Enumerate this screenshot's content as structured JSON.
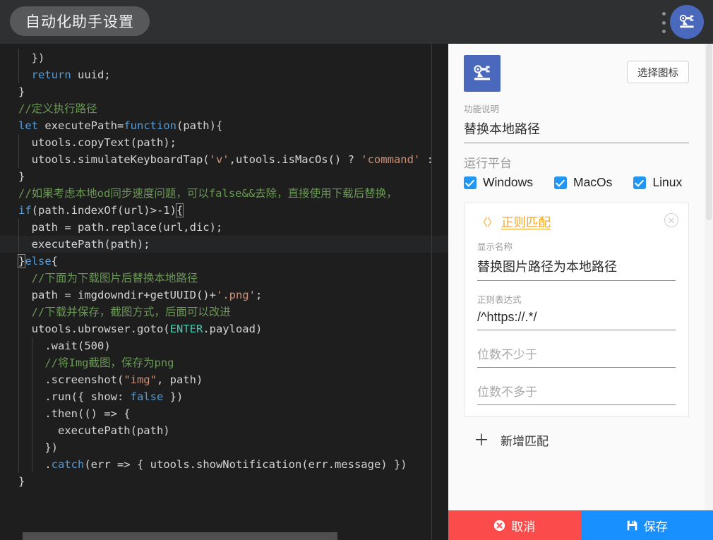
{
  "window": {
    "title": "自动化助手设置",
    "menu_icon": "kebab-menu-icon",
    "app_icon": "robot-arm-icon"
  },
  "editor": {
    "language": "javascript",
    "background": "#1e1e1e",
    "lines": [
      {
        "indent": 1,
        "tokens": [
          {
            "t": "plain",
            "s": "  })"
          }
        ]
      },
      {
        "indent": 1,
        "tokens": [
          {
            "t": "kw",
            "s": "  return"
          },
          {
            "t": "plain",
            "s": " uuid;"
          }
        ]
      },
      {
        "indent": 0,
        "tokens": [
          {
            "t": "plain",
            "s": "}"
          }
        ]
      },
      {
        "indent": 0,
        "tokens": [
          {
            "t": "cmt",
            "s": "//定义执行路径"
          }
        ]
      },
      {
        "indent": 0,
        "tokens": [
          {
            "t": "kw",
            "s": "let"
          },
          {
            "t": "plain",
            "s": " executePath="
          },
          {
            "t": "kw",
            "s": "function"
          },
          {
            "t": "plain",
            "s": "(path){"
          }
        ]
      },
      {
        "indent": 1,
        "tokens": [
          {
            "t": "plain",
            "s": "  utools.copyText(path);"
          }
        ]
      },
      {
        "indent": 1,
        "tokens": [
          {
            "t": "plain",
            "s": "  utools.simulateKeyboardTap("
          },
          {
            "t": "str",
            "s": "'v'"
          },
          {
            "t": "plain",
            "s": ",utools.isMacOs() ? "
          },
          {
            "t": "str",
            "s": "'command'"
          },
          {
            "t": "plain",
            "s": " :"
          }
        ]
      },
      {
        "indent": 0,
        "tokens": [
          {
            "t": "plain",
            "s": "}"
          }
        ]
      },
      {
        "indent": 0,
        "tokens": [
          {
            "t": "cmt",
            "s": "//如果考虑本地od同步速度问题，可以false&&去除，直接使用下载后替换，"
          }
        ]
      },
      {
        "indent": 0,
        "tokens": [
          {
            "t": "kw",
            "s": "if"
          },
          {
            "t": "plain",
            "s": "(path.indexOf(url)>-1)"
          },
          {
            "t": "brk",
            "s": "{"
          }
        ]
      },
      {
        "indent": 1,
        "tokens": [
          {
            "t": "plain",
            "s": "  path = path.replace(url,dic);"
          }
        ]
      },
      {
        "indent": 1,
        "current": true,
        "tokens": [
          {
            "t": "plain",
            "s": "  executePath(path);"
          }
        ]
      },
      {
        "indent": 0,
        "tokens": [
          {
            "t": "brk",
            "s": "}"
          },
          {
            "t": "kw",
            "s": "else"
          },
          {
            "t": "plain",
            "s": "{"
          }
        ]
      },
      {
        "indent": 1,
        "tokens": [
          {
            "t": "cmt",
            "s": "  //下面为下载图片后替换本地路径"
          }
        ]
      },
      {
        "indent": 1,
        "tokens": [
          {
            "t": "plain",
            "s": "  path = imgdowndir+getUUID()+"
          },
          {
            "t": "str",
            "s": "'.png'"
          },
          {
            "t": "plain",
            "s": ";"
          }
        ]
      },
      {
        "indent": 1,
        "tokens": [
          {
            "t": "cmt",
            "s": "  //下载并保存，截图方式，后面可以改进"
          }
        ]
      },
      {
        "indent": 1,
        "tokens": [
          {
            "t": "plain",
            "s": "  utools.ubrowser.goto("
          },
          {
            "t": "cls",
            "s": "ENTER"
          },
          {
            "t": "plain",
            "s": ".payload)"
          }
        ]
      },
      {
        "indent": 2,
        "tokens": [
          {
            "t": "plain",
            "s": "    .wait(500)"
          }
        ]
      },
      {
        "indent": 2,
        "tokens": [
          {
            "t": "cmt",
            "s": "    //将Img截图，保存为png"
          }
        ]
      },
      {
        "indent": 2,
        "tokens": [
          {
            "t": "plain",
            "s": "    .screenshot("
          },
          {
            "t": "str",
            "s": "\"img\""
          },
          {
            "t": "plain",
            "s": ", path)"
          }
        ]
      },
      {
        "indent": 2,
        "tokens": [
          {
            "t": "plain",
            "s": "    .run({ show: "
          },
          {
            "t": "kw",
            "s": "false"
          },
          {
            "t": "plain",
            "s": " })"
          }
        ]
      },
      {
        "indent": 2,
        "tokens": [
          {
            "t": "plain",
            "s": "    .then(() => {"
          }
        ]
      },
      {
        "indent": 2,
        "tokens": [
          {
            "t": "plain",
            "s": "      executePath(path)"
          }
        ]
      },
      {
        "indent": 2,
        "tokens": [
          {
            "t": "plain",
            "s": "    })"
          }
        ]
      },
      {
        "indent": 2,
        "tokens": [
          {
            "t": "plain",
            "s": "    ."
          },
          {
            "t": "mth",
            "s": "catch"
          },
          {
            "t": "plain",
            "s": "(err => { utools.showNotification(err.message) })"
          }
        ]
      },
      {
        "indent": 0,
        "tokens": [
          {
            "t": "plain",
            "s": "}"
          }
        ]
      }
    ]
  },
  "panel": {
    "pick_icon_label": "选择图标",
    "description_label": "功能说明",
    "description_value": "替换本地路径",
    "platform_label": "运行平台",
    "platforms": [
      {
        "name": "Windows",
        "checked": true
      },
      {
        "name": "MacOs",
        "checked": true
      },
      {
        "name": "Linux",
        "checked": true
      }
    ],
    "match_card": {
      "chevrons": "〈〉",
      "title": "正则匹配",
      "close_icon": "close-circle-icon",
      "display_name_label": "显示名称",
      "display_name_value": "替换图片路径为本地路径",
      "regex_label": "正则表达式",
      "regex_value": "/^https://.*/",
      "min_digits_placeholder": "位数不少于",
      "min_digits_value": "",
      "max_digits_placeholder": "位数不多于",
      "max_digits_value": ""
    },
    "add_match_label": "新增匹配",
    "add_match_icon": "plus-icon"
  },
  "footer": {
    "cancel_label": "取消",
    "cancel_icon": "cancel-circle-icon",
    "cancel_color": "#fb4b4b",
    "save_label": "保存",
    "save_icon": "save-disk-icon",
    "save_color": "#1890ff"
  }
}
